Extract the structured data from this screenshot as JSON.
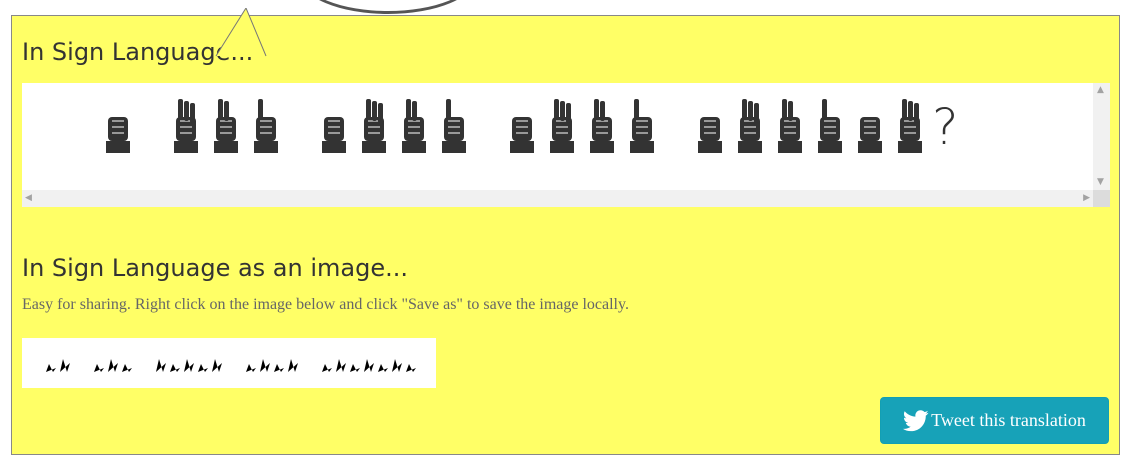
{
  "headings": {
    "sign_language": "In Sign Language...",
    "sign_language_image": "In Sign Language as an image..."
  },
  "description": "Easy for sharing. Right click on the image below and click \"Save as\" to save the image locally.",
  "translation": {
    "question_mark": "?"
  },
  "tweet_button": {
    "label": "Tweet this translation",
    "icon": "twitter-bird-icon",
    "color": "#17a2b8"
  },
  "colors": {
    "panel": "#ffff66",
    "hand": "#333333"
  }
}
